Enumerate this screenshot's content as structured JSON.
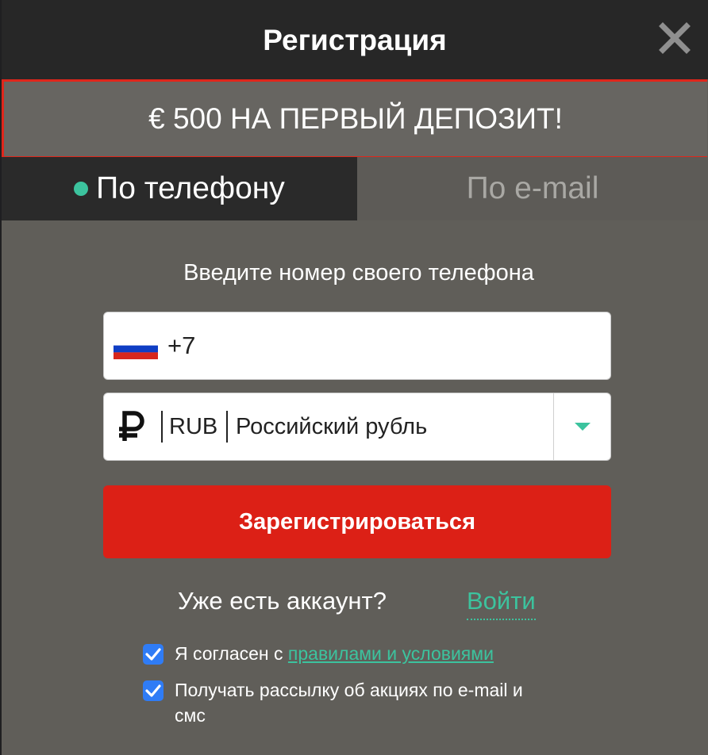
{
  "header": {
    "title": "Регистрация"
  },
  "promo": {
    "text": "€ 500 НА ПЕРВЫЙ ДЕПОЗИТ!"
  },
  "tabs": [
    {
      "label": "По телефону",
      "active": true
    },
    {
      "label": "По e-mail",
      "active": false
    }
  ],
  "form": {
    "prompt": "Введите номер своего телефона",
    "phone_value": "+7",
    "currency": {
      "code": "RUB",
      "name": "Российский рубль"
    },
    "register_label": "Зарегистрироваться"
  },
  "login": {
    "question": "Уже есть аккаунт?",
    "link": "Войти"
  },
  "agreements": {
    "terms_prefix": "Я согласен с ",
    "terms_link": "правилами и условиями",
    "newsletter": "Получать рассылку об акциях по e-mail и смс"
  },
  "colors": {
    "accent_green": "#3cc39e",
    "register_red": "#dc2016",
    "checkbox_blue": "#2f7cf6"
  },
  "icons": {
    "close": "close-icon",
    "flag": "russia-flag-icon",
    "currency": "ruble-icon",
    "dropdown": "chevron-down-icon",
    "check": "checkmark-icon"
  }
}
